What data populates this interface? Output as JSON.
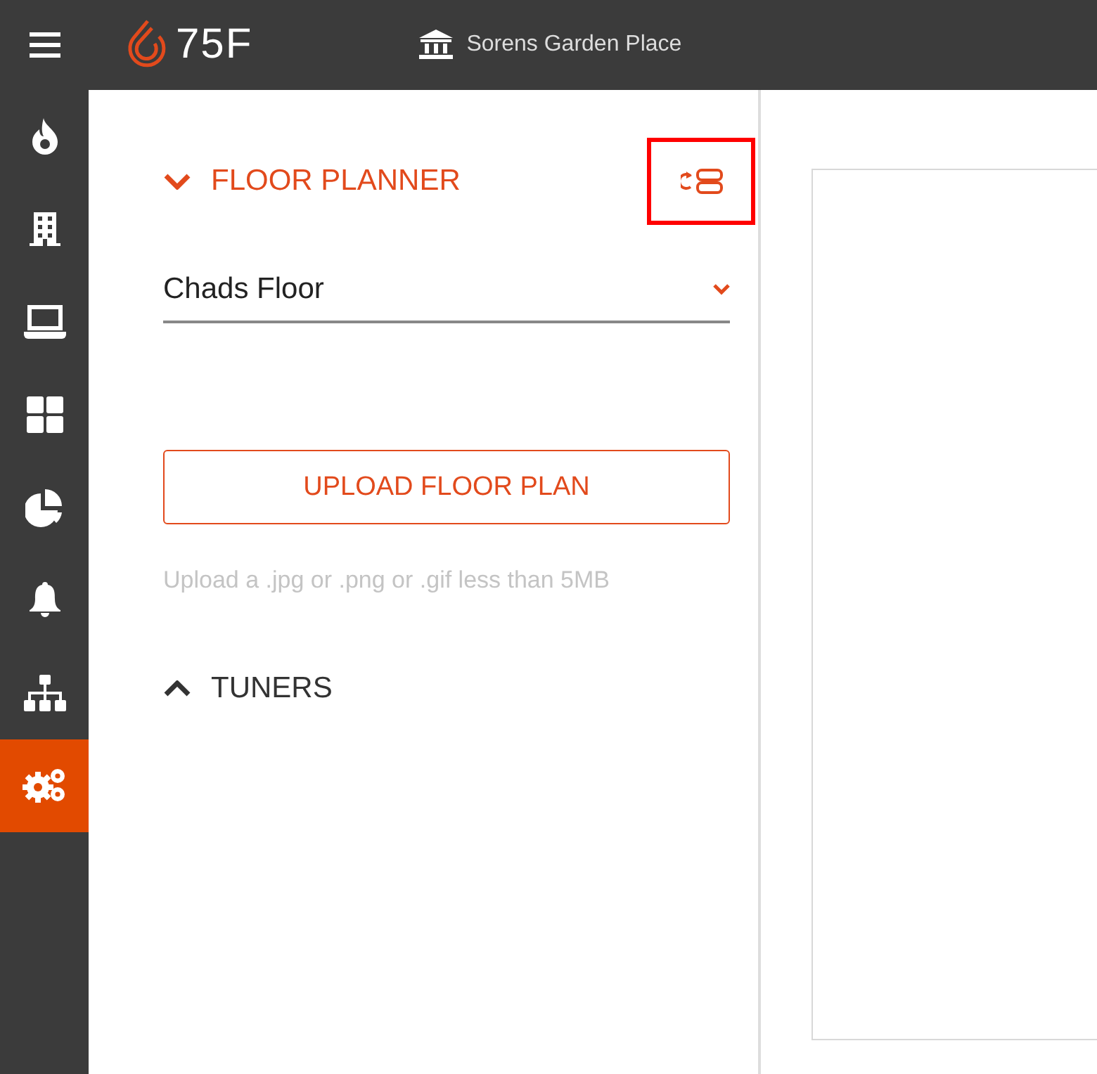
{
  "header": {
    "logo_text": "75F",
    "site": "Sorens Garden Place"
  },
  "sidebar": {
    "items": [
      {
        "kind": "flame",
        "selected": false
      },
      {
        "kind": "building",
        "selected": false
      },
      {
        "kind": "laptop",
        "selected": false
      },
      {
        "kind": "grid",
        "selected": false
      },
      {
        "kind": "pie",
        "selected": false
      },
      {
        "kind": "bell",
        "selected": false
      },
      {
        "kind": "hierarchy",
        "selected": false
      },
      {
        "kind": "gears",
        "selected": true
      }
    ]
  },
  "floor_planner": {
    "title": "FLOOR PLANNER",
    "expanded": true,
    "action_highlighted": true,
    "floor_select": {
      "value": "Chads Floor"
    },
    "upload_button": "UPLOAD FLOOR PLAN",
    "upload_hint": "Upload a .jpg or .png or .gif less than 5MB"
  },
  "tuners": {
    "title": "TUNERS",
    "expanded": false
  }
}
